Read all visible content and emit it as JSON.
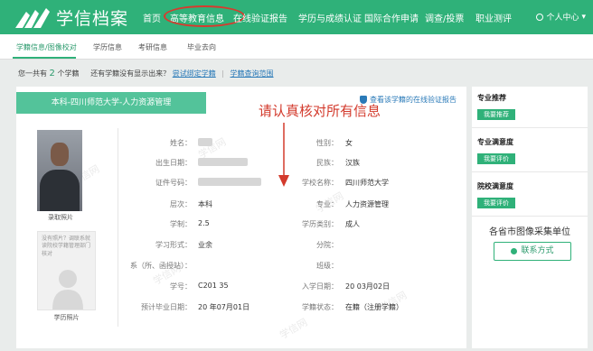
{
  "header": {
    "logo_text": "学信档案",
    "nav": [
      "首页",
      "高等教育信息",
      "在线验证报告",
      "学历与成绩认证",
      "国际合作申请",
      "调查/投票",
      "职业测评"
    ],
    "active_nav": "高等教育信息",
    "user_menu": "个人中心"
  },
  "subnav": {
    "tabs": [
      "学籍信息/图像校对",
      "学历信息",
      "考研信息",
      "毕业去向"
    ],
    "active": "学籍信息/图像校对"
  },
  "count_bar": {
    "prefix": "您一共有",
    "count": "2",
    "suffix": "个学籍",
    "question": "还有学籍没有显示出来？",
    "link1": "尝试绑定学籍",
    "separator": "|",
    "link2": "学籍查询范围"
  },
  "record": {
    "banner": "本科-四川师范大学-人力资源管理",
    "verify_link": "查看该学籍的在线验证报告",
    "annotation": "请认真核对所有信息",
    "photo1_caption": "录取照片",
    "photo2_message": "没有照片？调联系就读院校学籍管理部门核对",
    "photo2_caption": "学历照片",
    "left_fields": [
      {
        "label": "姓名：",
        "value": ""
      },
      {
        "label": "出生日期：",
        "value": ""
      },
      {
        "label": "证件号码：",
        "value": ""
      },
      {
        "label": "层次：",
        "value": "本科"
      },
      {
        "label": "学制：",
        "value": "2.5"
      },
      {
        "label": "学习形式：",
        "value": "业余"
      },
      {
        "label": "系（所、函授站）：",
        "value": ""
      },
      {
        "label": "学号：",
        "value": "C201          35"
      },
      {
        "label": "预计毕业日期：",
        "value": "20    年07月01日"
      }
    ],
    "right_fields": [
      {
        "label": "性别：",
        "value": "女"
      },
      {
        "label": "民族：",
        "value": "汉族"
      },
      {
        "label": "学校名称：",
        "value": "四川师范大学"
      },
      {
        "label": "专业：",
        "value": "人力资源管理"
      },
      {
        "label": "学历类别：",
        "value": "成人"
      },
      {
        "label": "分院：",
        "value": ""
      },
      {
        "label": "班级：",
        "value": ""
      },
      {
        "label": "入学日期：",
        "value": "20      03月02日"
      },
      {
        "label": "学籍状态：",
        "value": "在籍（注册学籍）"
      }
    ]
  },
  "right_panel": {
    "sections": [
      {
        "title": "专业推荐",
        "button": "我要推荐"
      },
      {
        "title": "专业满意度",
        "button": "我要评价"
      },
      {
        "title": "院校满意度",
        "button": "我要评价"
      }
    ],
    "unit_title": "各省市图像采集单位",
    "contact_button": "联系方式"
  },
  "watermark": "学信网",
  "colors": {
    "brand": "#2fb179",
    "banner": "#53c39a",
    "link": "#2a7ab8",
    "annotation": "#d33a2c"
  }
}
